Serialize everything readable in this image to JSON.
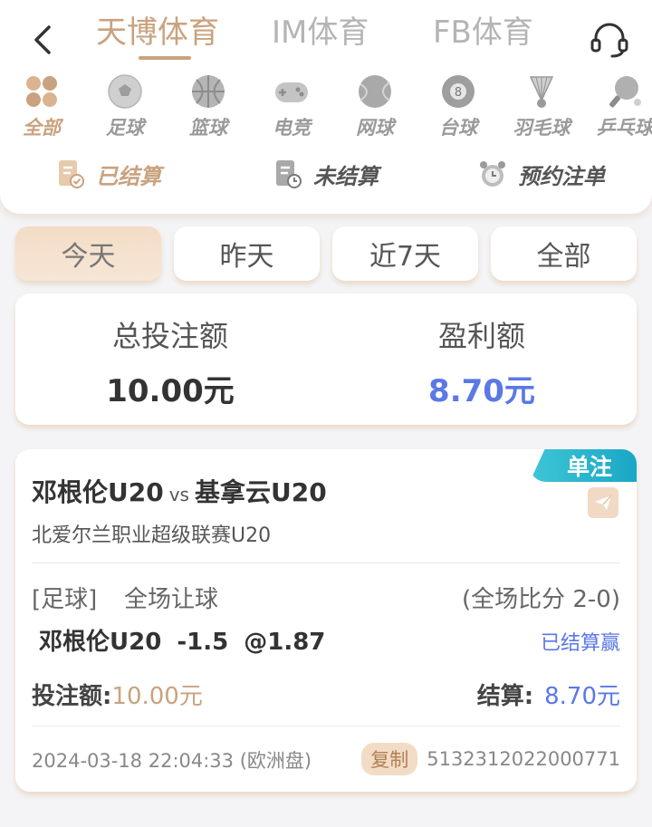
{
  "header": {
    "tabs": [
      {
        "label": "天博体育",
        "active": true
      },
      {
        "label": "IM体育",
        "active": false
      },
      {
        "label": "FB体育",
        "active": false
      }
    ],
    "back_icon": "chevron-left-icon",
    "service_icon": "headset-icon"
  },
  "sports": [
    {
      "label": "全部",
      "icon": "all-grid-icon",
      "active": true
    },
    {
      "label": "足球",
      "icon": "soccer-ball-icon",
      "active": false
    },
    {
      "label": "篮球",
      "icon": "basketball-icon",
      "active": false
    },
    {
      "label": "电竞",
      "icon": "gamepad-icon",
      "active": false
    },
    {
      "label": "网球",
      "icon": "tennis-ball-icon",
      "active": false
    },
    {
      "label": "台球",
      "icon": "billiard-ball-icon",
      "active": false
    },
    {
      "label": "羽毛球",
      "icon": "shuttlecock-icon",
      "active": false
    },
    {
      "label": "乒乓球",
      "icon": "ping-pong-icon",
      "active": false
    }
  ],
  "status_tabs": [
    {
      "label": "已结算",
      "icon": "settled-doc-icon",
      "active": true
    },
    {
      "label": "未结算",
      "icon": "pending-doc-icon",
      "active": false
    },
    {
      "label": "预约注单",
      "icon": "alarm-clock-icon",
      "active": false
    }
  ],
  "date_filters": [
    {
      "label": "今天",
      "active": true
    },
    {
      "label": "昨天",
      "active": false
    },
    {
      "label": "近7天",
      "active": false
    },
    {
      "label": "全部",
      "active": false
    }
  ],
  "summary": {
    "total_label": "总投注额",
    "total_value": "10.00元",
    "profit_label": "盈利额",
    "profit_value": "8.70元"
  },
  "bet": {
    "badge": "单注",
    "home": "邓根伦U20",
    "vs": "vs",
    "away": "基拿云U20",
    "league": "北爱尔兰职业超级联赛U20",
    "sport_type": "[足球]",
    "market": "全场让球",
    "score": "(全场比分 2-0)",
    "selection": "邓根伦U20  -1.5  @1.87",
    "settle_status": "已结算赢",
    "stake_label": "投注额:",
    "stake_value": "10.00元",
    "settle_label": "结算:",
    "settle_value": "8.70元",
    "time": "2024-03-18 22:04:33 (欧洲盘)",
    "copy_label": "复制",
    "order_id": "5132312022000771"
  },
  "colors": {
    "accent": "#c9a27f",
    "blue": "#5b78e6",
    "ribbon": "#1aa7c5"
  }
}
